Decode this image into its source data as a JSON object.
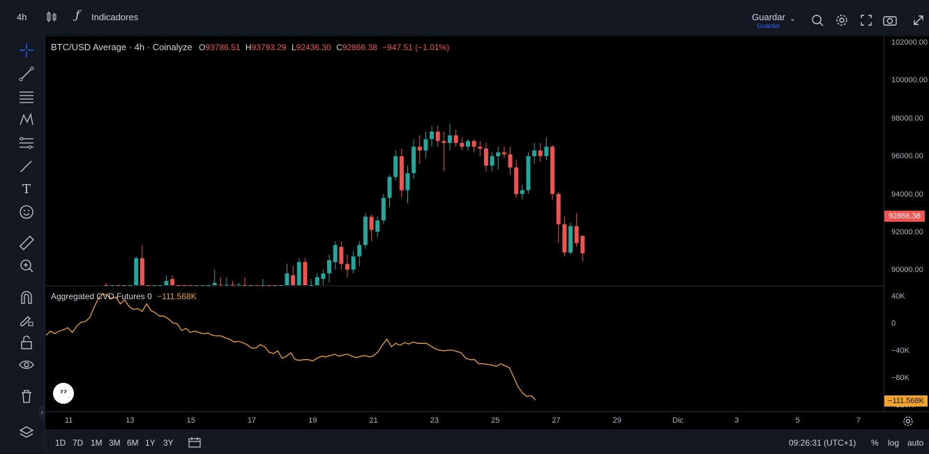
{
  "topbar": {
    "interval": "4h",
    "indicators_label": "Indicadores",
    "save_label": "Guardar",
    "save_sublabel": "Guardar"
  },
  "legend": {
    "symbol": "BTC/USD Average · 4h · Coinalyze",
    "o_label": "O",
    "o_value": "93786.51",
    "h_label": "H",
    "h_value": "93793.29",
    "l_label": "L",
    "l_value": "92436.30",
    "c_label": "C",
    "c_value": "92866.38",
    "change": "−947.51 (−1.01%)"
  },
  "indicator": {
    "name": "Aggregated CVD Futures 0",
    "value": "−111.568K"
  },
  "price_axis": [
    "102000.00",
    "100000.00",
    "98000.00",
    "96000.00",
    "94000.00",
    "92000.00",
    "90000.00"
  ],
  "price_badge": "92866.38",
  "cvd_axis": [
    "40K",
    "0",
    "−40K",
    "−80K",
    "−120K"
  ],
  "cvd_badge": "−111.568K",
  "time_axis": [
    "11",
    "13",
    "15",
    "17",
    "19",
    "21",
    "23",
    "25",
    "27",
    "29",
    "Dic",
    "3",
    "5",
    "7"
  ],
  "bottombar": {
    "ranges": [
      "1D",
      "7D",
      "1M",
      "3M",
      "6M",
      "1Y",
      "3Y"
    ],
    "clock": "09:26:31 (UTC+1)",
    "percent": "%",
    "log": "log",
    "auto": "auto"
  },
  "colors": {
    "up": "#26a69a",
    "down": "#ef5350",
    "cvd": "#f0a22a",
    "background": "#000000"
  },
  "chart_data": [
    {
      "type": "candlestick",
      "title": "BTC/USD Average · 4h · Coinalyze",
      "ylim": [
        89000,
        102500
      ],
      "candles": [
        {
          "o": 90500,
          "h": 91300,
          "l": 89000,
          "c": 90000
        },
        {
          "o": 90200,
          "h": 91000,
          "l": 89000,
          "c": 90600
        },
        {
          "o": 90600,
          "h": 91200,
          "l": 89000,
          "c": 89800
        },
        {
          "o": 89600,
          "h": 90900,
          "l": 89000,
          "c": 90300
        },
        {
          "o": 89500,
          "h": 90800,
          "l": 89000,
          "c": 89800
        },
        {
          "o": 89000,
          "h": 92700,
          "l": 89000,
          "c": 92600
        },
        {
          "o": 92600,
          "h": 93300,
          "l": 89800,
          "c": 90100
        },
        {
          "o": 90100,
          "h": 90600,
          "l": 89300,
          "c": 89900
        },
        {
          "o": 89900,
          "h": 90400,
          "l": 89200,
          "c": 90400
        },
        {
          "o": 90200,
          "h": 91000,
          "l": 89800,
          "c": 90800
        },
        {
          "o": 90700,
          "h": 91700,
          "l": 90500,
          "c": 91400
        },
        {
          "o": 91500,
          "h": 91700,
          "l": 89600,
          "c": 89700
        },
        {
          "o": 89700,
          "h": 90000,
          "l": 89000,
          "c": 89600
        },
        {
          "o": 89500,
          "h": 89800,
          "l": 89000,
          "c": 89300
        },
        {
          "o": 89300,
          "h": 89700,
          "l": 89000,
          "c": 89200
        },
        {
          "o": 89000,
          "h": 89800,
          "l": 89000,
          "c": 89600
        },
        {
          "o": 89300,
          "h": 90600,
          "l": 89000,
          "c": 90500
        },
        {
          "o": 90300,
          "h": 91200,
          "l": 90000,
          "c": 90900
        },
        {
          "o": 90700,
          "h": 92000,
          "l": 90600,
          "c": 91300
        },
        {
          "o": 91200,
          "h": 91600,
          "l": 90800,
          "c": 91100
        },
        {
          "o": 91000,
          "h": 91600,
          "l": 90400,
          "c": 91200
        },
        {
          "o": 91200,
          "h": 91400,
          "l": 90100,
          "c": 90500
        },
        {
          "o": 90700,
          "h": 91300,
          "l": 90200,
          "c": 91200
        },
        {
          "o": 91100,
          "h": 91600,
          "l": 89800,
          "c": 90100
        },
        {
          "o": 90300,
          "h": 91200,
          "l": 90000,
          "c": 90800
        },
        {
          "o": 90700,
          "h": 91000,
          "l": 90000,
          "c": 90600
        },
        {
          "o": 90500,
          "h": 91500,
          "l": 89900,
          "c": 90900
        },
        {
          "o": 90900,
          "h": 91100,
          "l": 89900,
          "c": 90200
        },
        {
          "o": 90400,
          "h": 90600,
          "l": 89300,
          "c": 89800
        },
        {
          "o": 89900,
          "h": 91000,
          "l": 89600,
          "c": 90800
        },
        {
          "o": 90700,
          "h": 92300,
          "l": 90500,
          "c": 91800
        },
        {
          "o": 91700,
          "h": 92200,
          "l": 89900,
          "c": 90400
        },
        {
          "o": 90400,
          "h": 92600,
          "l": 90200,
          "c": 92400
        },
        {
          "o": 92400,
          "h": 92600,
          "l": 90400,
          "c": 90600
        },
        {
          "o": 90700,
          "h": 91500,
          "l": 90300,
          "c": 91100
        },
        {
          "o": 91100,
          "h": 91800,
          "l": 90600,
          "c": 91600
        },
        {
          "o": 91500,
          "h": 92000,
          "l": 91000,
          "c": 91800
        },
        {
          "o": 91800,
          "h": 92800,
          "l": 91300,
          "c": 92500
        },
        {
          "o": 92400,
          "h": 93500,
          "l": 92000,
          "c": 93300
        },
        {
          "o": 93200,
          "h": 93500,
          "l": 92000,
          "c": 92300
        },
        {
          "o": 92300,
          "h": 92800,
          "l": 91600,
          "c": 92000
        },
        {
          "o": 92000,
          "h": 93000,
          "l": 91800,
          "c": 92700
        },
        {
          "o": 92700,
          "h": 93500,
          "l": 92200,
          "c": 93300
        },
        {
          "o": 93300,
          "h": 95000,
          "l": 93100,
          "c": 94800
        },
        {
          "o": 94800,
          "h": 94900,
          "l": 93500,
          "c": 94100
        },
        {
          "o": 94000,
          "h": 94800,
          "l": 93700,
          "c": 94600
        },
        {
          "o": 94600,
          "h": 96000,
          "l": 94400,
          "c": 95800
        },
        {
          "o": 95800,
          "h": 97000,
          "l": 95300,
          "c": 96900
        },
        {
          "o": 96900,
          "h": 98300,
          "l": 96700,
          "c": 98000
        },
        {
          "o": 98000,
          "h": 98400,
          "l": 95800,
          "c": 96200
        },
        {
          "o": 96200,
          "h": 97500,
          "l": 95500,
          "c": 97100
        },
        {
          "o": 97100,
          "h": 98900,
          "l": 96800,
          "c": 98500
        },
        {
          "o": 98500,
          "h": 99100,
          "l": 97600,
          "c": 98300
        },
        {
          "o": 98300,
          "h": 99300,
          "l": 97900,
          "c": 98900
        },
        {
          "o": 98900,
          "h": 99600,
          "l": 98500,
          "c": 99300
        },
        {
          "o": 99300,
          "h": 99600,
          "l": 98500,
          "c": 98800
        },
        {
          "o": 98800,
          "h": 99300,
          "l": 97200,
          "c": 98700
        },
        {
          "o": 98700,
          "h": 99700,
          "l": 98300,
          "c": 99100
        },
        {
          "o": 99100,
          "h": 99400,
          "l": 98500,
          "c": 98700
        },
        {
          "o": 98700,
          "h": 99000,
          "l": 98300,
          "c": 98500
        },
        {
          "o": 98500,
          "h": 98900,
          "l": 98300,
          "c": 98800
        },
        {
          "o": 98800,
          "h": 98900,
          "l": 98200,
          "c": 98500
        },
        {
          "o": 98500,
          "h": 98800,
          "l": 98000,
          "c": 98400
        },
        {
          "o": 98400,
          "h": 98700,
          "l": 97200,
          "c": 97500
        },
        {
          "o": 97500,
          "h": 98200,
          "l": 97200,
          "c": 98000
        },
        {
          "o": 98000,
          "h": 98500,
          "l": 97300,
          "c": 98200
        },
        {
          "o": 98200,
          "h": 98500,
          "l": 97900,
          "c": 98100
        },
        {
          "o": 98100,
          "h": 98500,
          "l": 97000,
          "c": 97400
        },
        {
          "o": 97400,
          "h": 97800,
          "l": 95800,
          "c": 96000
        },
        {
          "o": 96000,
          "h": 96500,
          "l": 95700,
          "c": 96200
        },
        {
          "o": 96200,
          "h": 98200,
          "l": 96000,
          "c": 98000
        },
        {
          "o": 98000,
          "h": 98700,
          "l": 97600,
          "c": 98300
        },
        {
          "o": 98300,
          "h": 98700,
          "l": 97700,
          "c": 98000
        },
        {
          "o": 98000,
          "h": 99000,
          "l": 97800,
          "c": 98500
        },
        {
          "o": 98500,
          "h": 98600,
          "l": 95700,
          "c": 96000
        },
        {
          "o": 96000,
          "h": 96100,
          "l": 93400,
          "c": 94400
        },
        {
          "o": 94400,
          "h": 94800,
          "l": 92700,
          "c": 92900
        },
        {
          "o": 92900,
          "h": 94500,
          "l": 92800,
          "c": 94300
        },
        {
          "o": 94300,
          "h": 95000,
          "l": 93200,
          "c": 93400
        },
        {
          "o": 93786.51,
          "h": 93793.29,
          "l": 92436.3,
          "c": 92866.38
        }
      ]
    },
    {
      "type": "line",
      "title": "Aggregated CVD Futures 0",
      "ylim": [
        -125000,
        45000
      ],
      "series": [
        {
          "name": "Aggregated CVD Futures 0",
          "values": [
            -16000,
            -10000,
            -14000,
            -10000,
            -8000,
            -5000,
            -12000,
            -3000,
            3000,
            4000,
            10000,
            25000,
            38000,
            45000,
            42000,
            38000,
            40000,
            30000,
            36000,
            26000,
            22000,
            23000,
            19000,
            30000,
            20000,
            17000,
            12000,
            12000,
            8000,
            2000,
            1000,
            -9000,
            -6000,
            -12000,
            -10000,
            -12000,
            -14000,
            -13000,
            -16000,
            -17000,
            -17000,
            -20000,
            -22000,
            -26000,
            -25000,
            -27000,
            -30000,
            -35000,
            -35000,
            -30000,
            -33000,
            -41000,
            -43000,
            -39000,
            -50000,
            -47000,
            -42000,
            -52000,
            -53000,
            -52000,
            -52000,
            -54000,
            -50000,
            -47000,
            -48000,
            -46000,
            -44000,
            -47000,
            -45000,
            -44000,
            -47000,
            -49000,
            -47000,
            -46000,
            -48000,
            -46000,
            -40000,
            -30000,
            -22000,
            -33000,
            -28000,
            -31000,
            -27000,
            -29000,
            -26000,
            -28000,
            -28000,
            -28000,
            -32000,
            -36000,
            -38000,
            -39000,
            -38000,
            -38000,
            -40000,
            -42000,
            -50000,
            -52000,
            -52000,
            -58000,
            -58000,
            -59000,
            -60000,
            -62000,
            -58000,
            -61000,
            -64000,
            -78000,
            -92000,
            -101000,
            -106000,
            -105000,
            -111568
          ]
        }
      ]
    }
  ]
}
